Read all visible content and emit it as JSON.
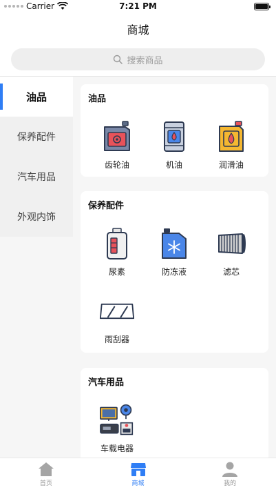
{
  "status": {
    "carrier": "Carrier",
    "time": "7:21 PM",
    "battery_level": 1.0
  },
  "nav": {
    "title": "商城"
  },
  "search": {
    "placeholder": "搜索商品"
  },
  "sidebar": {
    "items": [
      {
        "label": "油品",
        "active": true
      },
      {
        "label": "保养配件",
        "active": false
      },
      {
        "label": "汽车用品",
        "active": false
      },
      {
        "label": "外观内饰",
        "active": false
      }
    ]
  },
  "sections": [
    {
      "title": "油品",
      "products": [
        {
          "label": "齿轮油",
          "icon": "gear-oil-icon"
        },
        {
          "label": "机油",
          "icon": "engine-oil-icon"
        },
        {
          "label": "润滑油",
          "icon": "lubricant-icon"
        }
      ]
    },
    {
      "title": "保养配件",
      "products": [
        {
          "label": "尿素",
          "icon": "urea-icon"
        },
        {
          "label": "防冻液",
          "icon": "antifreeze-icon"
        },
        {
          "label": "滤芯",
          "icon": "filter-icon"
        },
        {
          "label": "雨刮器",
          "icon": "wiper-icon"
        }
      ]
    },
    {
      "title": "汽车用品",
      "products": [
        {
          "label": "车载电器",
          "icon": "car-electronics-icon"
        }
      ]
    }
  ],
  "tabbar": {
    "items": [
      {
        "label": "首页",
        "icon": "home-icon",
        "active": false
      },
      {
        "label": "商城",
        "icon": "store-icon",
        "active": true
      },
      {
        "label": "我的",
        "icon": "profile-icon",
        "active": false
      }
    ]
  },
  "colors": {
    "accent": "#2f7ef5",
    "inactive": "#9a9a9a",
    "background": "#f6f6f6"
  }
}
